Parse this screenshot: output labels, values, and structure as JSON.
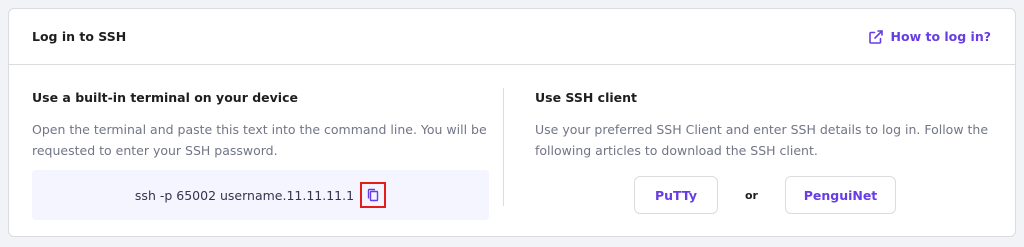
{
  "card": {
    "title": "Log in to SSH",
    "help_link": "How to log in?",
    "help_icon": "external-link-icon"
  },
  "left": {
    "title": "Use a built-in terminal on your device",
    "description": "Open the terminal and paste this text into the command line. You will be requested to enter your SSH password.",
    "command": "ssh -p 65002 username.11.11.11.1",
    "copy_icon": "copy-icon"
  },
  "right": {
    "title": "Use SSH client",
    "description": "Use your preferred SSH Client and enter SSH details to log in. Follow the following articles to download the SSH client.",
    "client_1": "PuTTy",
    "separator": "or",
    "client_2": "PenguiNet"
  },
  "colors": {
    "accent": "#673de6",
    "highlight": "#e41c1c",
    "command_bg": "#f4f5ff"
  }
}
